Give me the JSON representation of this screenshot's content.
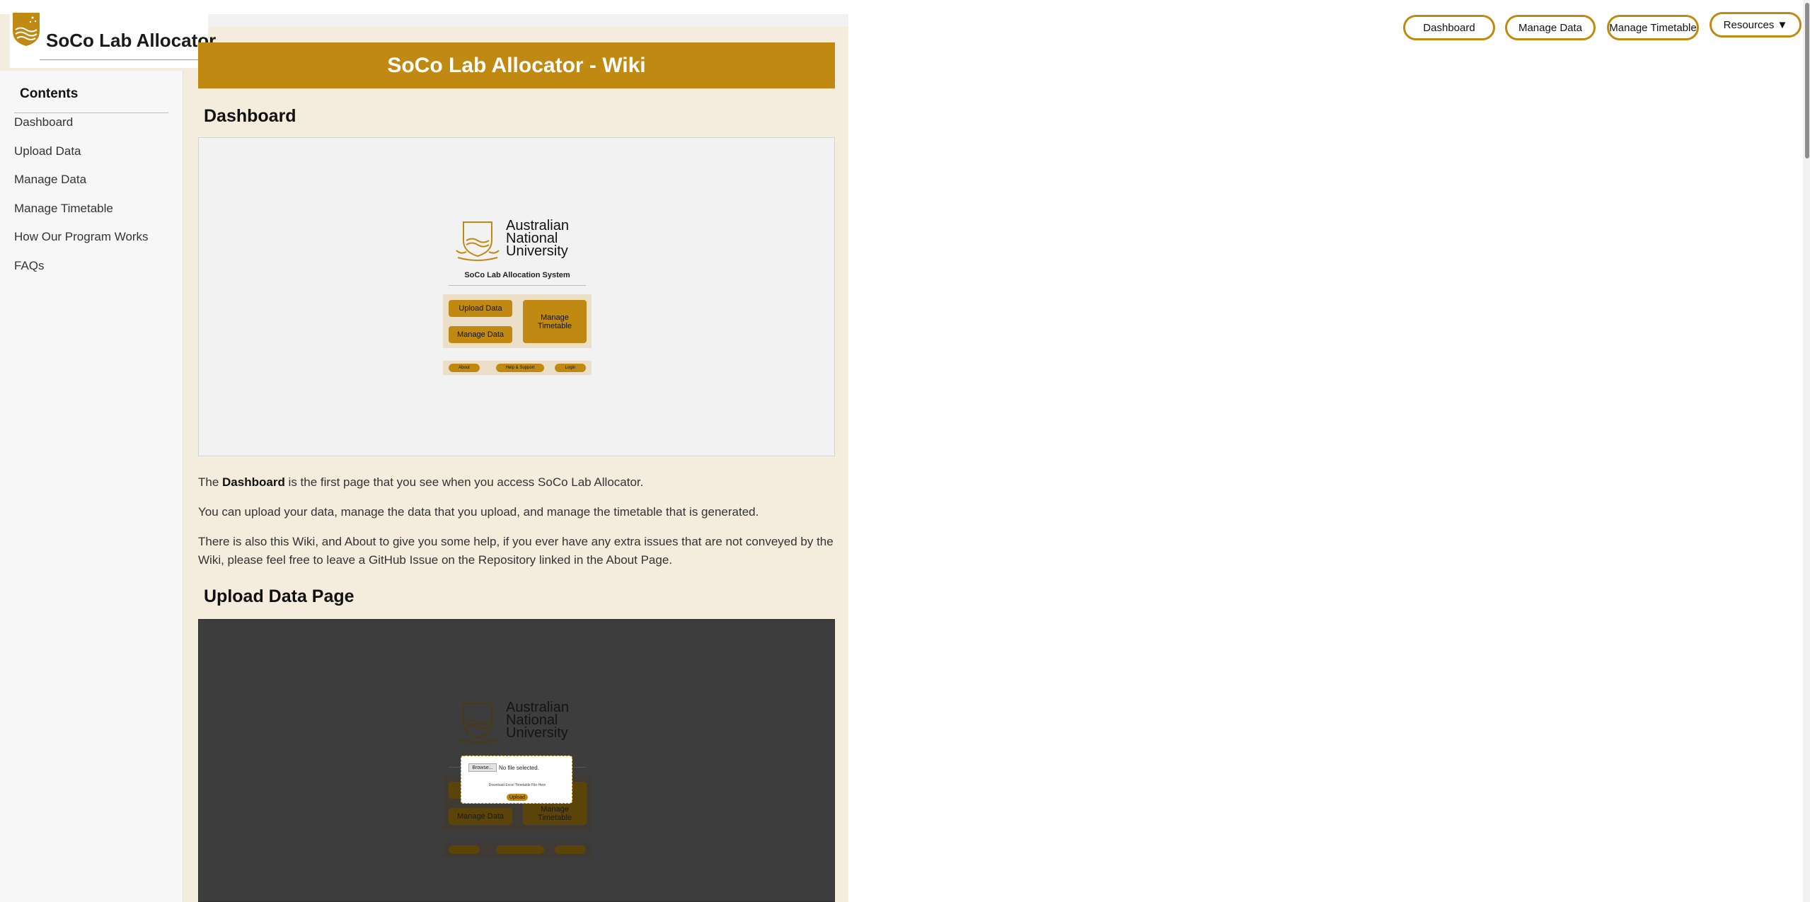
{
  "app": {
    "title": "SoCo Lab Allocator"
  },
  "nav": {
    "dashboard": "Dashboard",
    "manage_data": "Manage Data",
    "manage_timetable": "Manage Timetable",
    "resources": "Resources ▼"
  },
  "sidebar": {
    "heading": "Contents",
    "items": [
      {
        "label": "Dashboard"
      },
      {
        "label": "Upload Data"
      },
      {
        "label": "Manage Data"
      },
      {
        "label": "Manage Timetable"
      },
      {
        "label": "How Our Program Works"
      },
      {
        "label": "FAQs"
      }
    ]
  },
  "banner": {
    "title": "SoCo Lab Allocator - Wiki"
  },
  "sections": {
    "dashboard": {
      "heading": "Dashboard",
      "p1_before": "The ",
      "p1_bold": "Dashboard",
      "p1_after": " is the first page that you see when you access SoCo Lab Allocator.",
      "p2": "You can upload your data, manage the data that you upload, and manage the timetable that is generated.",
      "p3": "There is also this Wiki, and About to give you some help, if you ever have any extra issues that are not conveyed by the Wiki, please feel free to leave a GitHub Issue on the Repository linked in the About Page."
    },
    "upload": {
      "heading": "Upload Data Page"
    }
  },
  "preview": {
    "university_line1": "Australian",
    "university_line2": "National",
    "university_line3": "University",
    "system_title": "SoCo Lab Allocation System",
    "upload_data": "Upload Data",
    "manage_data": "Manage Data",
    "manage_timetable": "Manage Timetable",
    "about": "About",
    "help_support": "Help & Support",
    "login": "Login",
    "browse": "Browse...",
    "no_file": "No file selected.",
    "download_template": "Download Excel Timetable File Here",
    "upload": "Upload"
  },
  "colors": {
    "accent": "#c08a12",
    "page_bg": "#f4ecdd",
    "sidebar_bg": "#f7f7f7"
  }
}
